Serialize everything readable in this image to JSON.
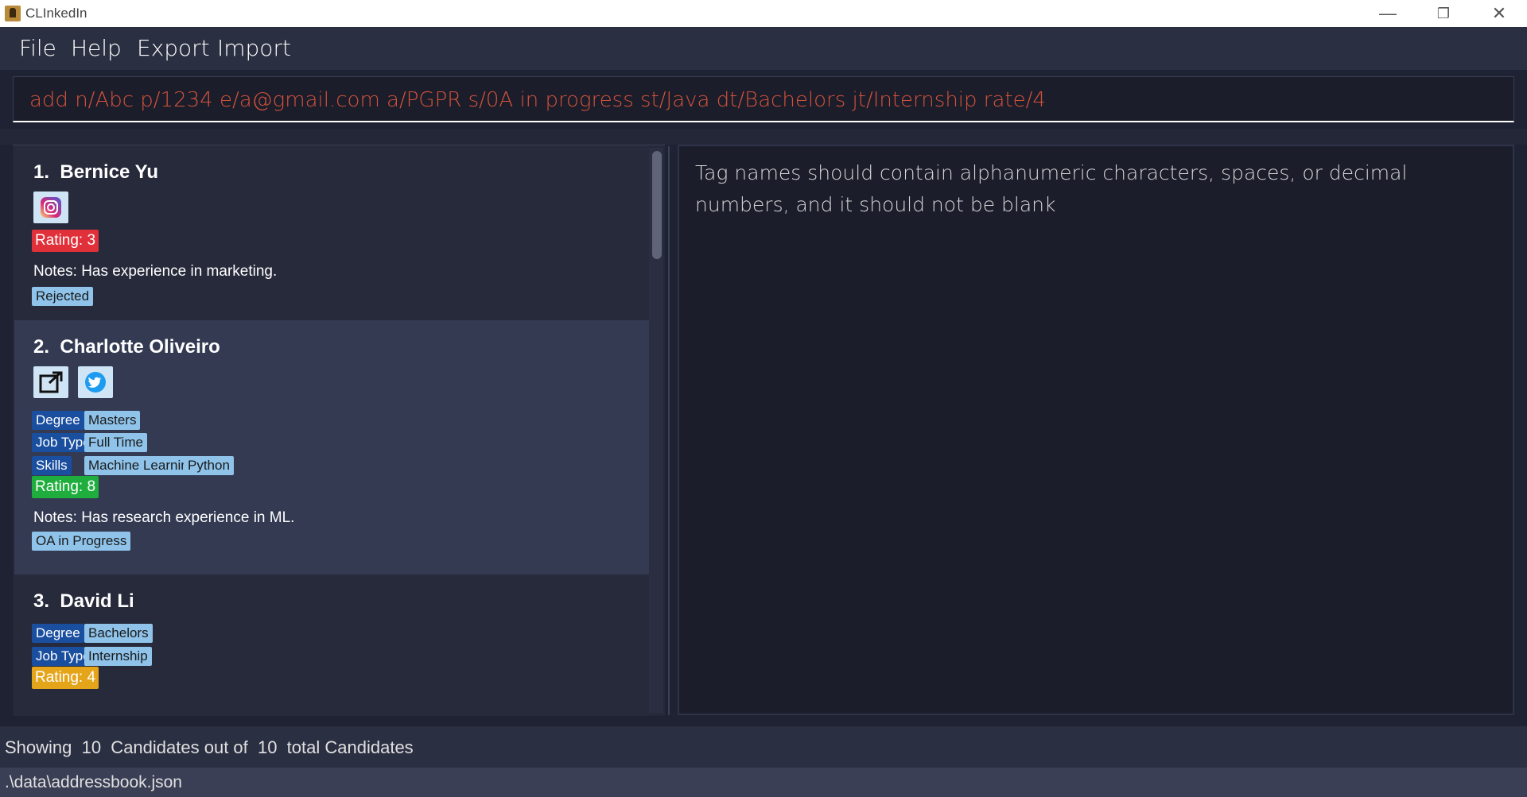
{
  "window": {
    "title": "CLInkedIn",
    "minimize": "—",
    "maximize": "❐",
    "close": "✕"
  },
  "menu": {
    "items": [
      "File",
      "Help",
      "Export",
      "Import"
    ]
  },
  "command": {
    "value": "add n/Abc p/1234 e/a@gmail.com a/PGPR s/0A in progress st/Java dt/Bachelors jt/Internship rate/4"
  },
  "result": {
    "message": "Tag names should contain alphanumeric characters, spaces, or decimal numbers, and it should not be blank"
  },
  "candidates": [
    {
      "index": "1.",
      "name": "Bernice Yu",
      "rating": "Rating: 3",
      "rating_color": "#e0303a",
      "notes": "Notes: Has experience in marketing.",
      "status": "Rejected",
      "links": [
        "instagram-icon"
      ]
    },
    {
      "index": "2.",
      "name": "Charlotte Oliveiro",
      "degree_label": "Degree",
      "degree": "Masters",
      "jobtype_label": "Job Type",
      "jobtype": "Full Time",
      "skills_label": "Skills",
      "skills": [
        "Machine Learning",
        "Python"
      ],
      "rating": "Rating: 8",
      "rating_color": "#1fae3d",
      "notes": "Notes: Has research experience in ML.",
      "status": "OA in Progress",
      "links": [
        "external-link-icon",
        "twitter-icon"
      ]
    },
    {
      "index": "3.",
      "name": "David Li",
      "degree_label": "Degree",
      "degree": "Bachelors",
      "jobtype_label": "Job Type",
      "jobtype": "Internship",
      "rating": "Rating: 4",
      "rating_color": "#e5a51b"
    }
  ],
  "status": {
    "summary": "Showing  10  Candidates out of  10  total Candidates",
    "file_path": ".\\data\\addressbook.json"
  },
  "colors": {
    "background": "#1f2233",
    "command_text": "#d4523a",
    "tag_dark": "#1a4fa0",
    "tag_light": "#8fc3ea"
  }
}
